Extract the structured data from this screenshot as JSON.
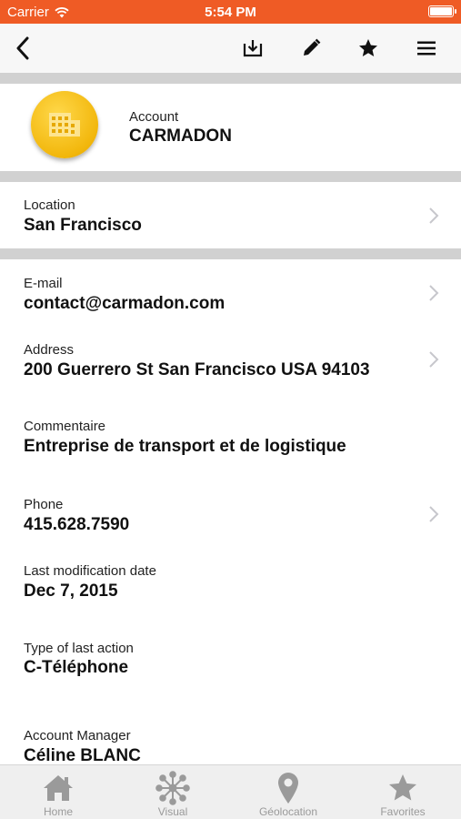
{
  "status_bar": {
    "carrier": "Carrier",
    "time": "5:54 PM"
  },
  "account": {
    "label": "Account",
    "name": "CARMADON"
  },
  "fields": [
    {
      "label": "Location",
      "value": "San Francisco"
    },
    {
      "label": "E-mail",
      "value": "contact@carmadon.com"
    },
    {
      "label": "Address",
      "value": "200 Guerrero St San Francisco USA 94103"
    },
    {
      "label": "Commentaire",
      "value": "Entreprise de transport et de logistique"
    },
    {
      "label": "Phone",
      "value": "415.628.7590"
    },
    {
      "label": "Last modification date",
      "value": "Dec 7, 2015"
    },
    {
      "label": "Type of last action",
      "value": "C-Téléphone"
    },
    {
      "label": "Account Manager",
      "value": "Céline BLANC"
    }
  ],
  "tabs": [
    {
      "label": "Home",
      "icon": "home-icon"
    },
    {
      "label": "Visual",
      "icon": "visual-icon"
    },
    {
      "label": "Géolocation",
      "icon": "map-pin-icon"
    },
    {
      "label": "Favorites",
      "icon": "star-icon"
    }
  ],
  "colors": {
    "status_bar": "#ef5b25",
    "account_logo": "#f2b70c",
    "separator": "#d1d1d1",
    "tab_icon": "#9a9a9a"
  }
}
